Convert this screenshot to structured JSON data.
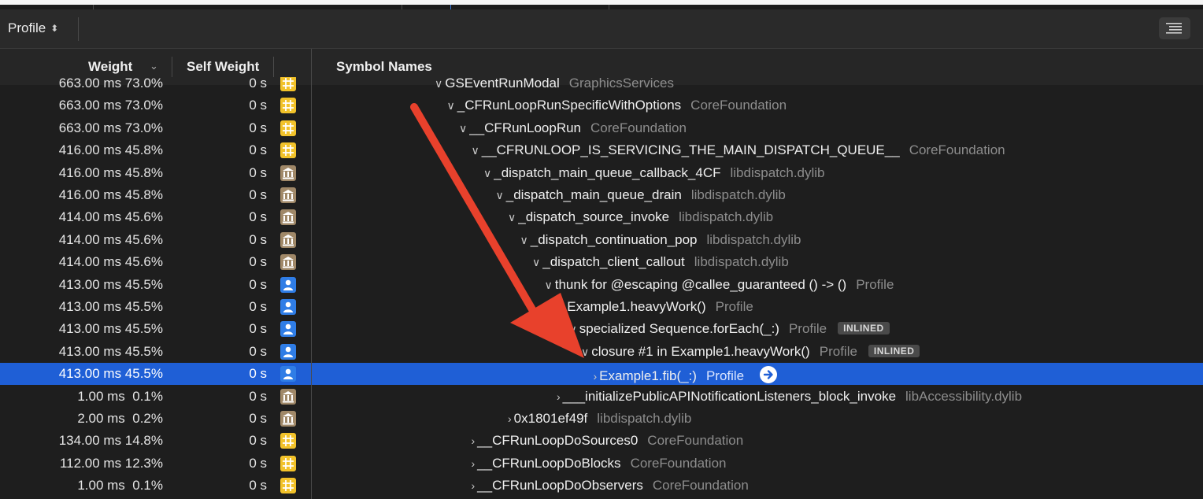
{
  "toolbar": {
    "profile_label": "Profile",
    "updown_glyph": "⌃⌄"
  },
  "header": {
    "weight": "Weight",
    "self_weight": "Self Weight",
    "symbol_names": "Symbol Names"
  },
  "rows": [
    {
      "weight": "663.00 ms",
      "pct": "73.0%",
      "self": "0 s",
      "cat": "framework",
      "depth": 0,
      "open": true,
      "name": "GSEventRunModal",
      "lib": "GraphicsServices",
      "clipped": true
    },
    {
      "weight": "663.00 ms",
      "pct": "73.0%",
      "self": "0 s",
      "cat": "framework",
      "depth": 1,
      "open": true,
      "name": "_CFRunLoopRunSpecificWithOptions",
      "lib": "CoreFoundation"
    },
    {
      "weight": "663.00 ms",
      "pct": "73.0%",
      "self": "0 s",
      "cat": "framework",
      "depth": 2,
      "open": true,
      "name": "__CFRunLoopRun",
      "lib": "CoreFoundation"
    },
    {
      "weight": "416.00 ms",
      "pct": "45.8%",
      "self": "0 s",
      "cat": "framework",
      "depth": 3,
      "open": true,
      "name": "__CFRUNLOOP_IS_SERVICING_THE_MAIN_DISPATCH_QUEUE__",
      "lib": "CoreFoundation"
    },
    {
      "weight": "416.00 ms",
      "pct": "45.8%",
      "self": "0 s",
      "cat": "library",
      "depth": 4,
      "open": true,
      "name": "_dispatch_main_queue_callback_4CF",
      "lib": "libdispatch.dylib"
    },
    {
      "weight": "416.00 ms",
      "pct": "45.8%",
      "self": "0 s",
      "cat": "library",
      "depth": 5,
      "open": true,
      "name": "_dispatch_main_queue_drain",
      "lib": "libdispatch.dylib"
    },
    {
      "weight": "414.00 ms",
      "pct": "45.6%",
      "self": "0 s",
      "cat": "library",
      "depth": 6,
      "open": true,
      "name": "_dispatch_source_invoke",
      "lib": "libdispatch.dylib"
    },
    {
      "weight": "414.00 ms",
      "pct": "45.6%",
      "self": "0 s",
      "cat": "library",
      "depth": 7,
      "open": true,
      "name": "_dispatch_continuation_pop",
      "lib": "libdispatch.dylib"
    },
    {
      "weight": "414.00 ms",
      "pct": "45.6%",
      "self": "0 s",
      "cat": "library",
      "depth": 8,
      "open": true,
      "name": "_dispatch_client_callout",
      "lib": "libdispatch.dylib"
    },
    {
      "weight": "413.00 ms",
      "pct": "45.5%",
      "self": "0 s",
      "cat": "user",
      "depth": 9,
      "open": true,
      "name": "thunk for @escaping @callee_guaranteed () -> ()",
      "lib": "Profile"
    },
    {
      "weight": "413.00 ms",
      "pct": "45.5%",
      "self": "0 s",
      "cat": "user",
      "depth": 10,
      "open": true,
      "name": "Example1.heavyWork()",
      "lib": "Profile"
    },
    {
      "weight": "413.00 ms",
      "pct": "45.5%",
      "self": "0 s",
      "cat": "user",
      "depth": 11,
      "open": true,
      "name": "specialized Sequence.forEach(_:)",
      "lib": "Profile",
      "badge": "INLINED"
    },
    {
      "weight": "413.00 ms",
      "pct": "45.5%",
      "self": "0 s",
      "cat": "user",
      "depth": 12,
      "open": true,
      "name": "closure #1 in Example1.heavyWork()",
      "lib": "Profile",
      "badge": "INLINED"
    },
    {
      "weight": "413.00 ms",
      "pct": "45.5%",
      "self": "0 s",
      "cat": "user",
      "depth": 13,
      "open": false,
      "name": "Example1.fib(_:)",
      "lib": "Profile",
      "selected": true,
      "goto": true
    },
    {
      "weight": "1.00 ms",
      "pct": "0.1%",
      "self": "0 s",
      "cat": "library",
      "depth": 10,
      "open": false,
      "name": "___initializePublicAPINotificationListeners_block_invoke",
      "lib": "libAccessibility.dylib"
    },
    {
      "weight": "2.00 ms",
      "pct": "0.2%",
      "self": "0 s",
      "cat": "library",
      "depth": 6,
      "open": false,
      "name": "0x1801ef49f",
      "lib": "libdispatch.dylib"
    },
    {
      "weight": "134.00 ms",
      "pct": "14.8%",
      "self": "0 s",
      "cat": "framework",
      "depth": 3,
      "open": false,
      "name": "__CFRunLoopDoSources0",
      "lib": "CoreFoundation"
    },
    {
      "weight": "112.00 ms",
      "pct": "12.3%",
      "self": "0 s",
      "cat": "framework",
      "depth": 3,
      "open": false,
      "name": "__CFRunLoopDoBlocks",
      "lib": "CoreFoundation"
    },
    {
      "weight": "1.00 ms",
      "pct": "0.1%",
      "self": "0 s",
      "cat": "framework",
      "depth": 3,
      "open": false,
      "name": "__CFRunLoopDoObservers",
      "lib": "CoreFoundation"
    }
  ],
  "colors": {
    "selection": "#1f5fd6",
    "framework_icon": "#f2c22a",
    "library_icon": "#a08868",
    "user_icon": "#2f7de6",
    "annotation_arrow": "#e8412c"
  },
  "icons": {
    "framework": "framework-icon",
    "library": "library-icon",
    "user": "user-code-icon"
  }
}
